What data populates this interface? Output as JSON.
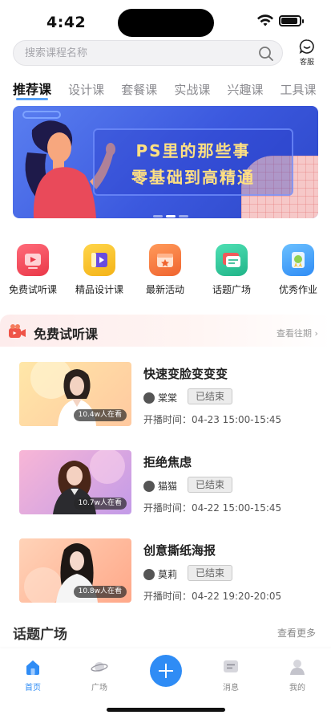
{
  "status_bar": {
    "time": "4:42"
  },
  "search": {
    "placeholder": "搜索课程名称"
  },
  "service": {
    "label": "客服"
  },
  "tabs": [
    {
      "label": "推荐课",
      "active": true
    },
    {
      "label": "设计课"
    },
    {
      "label": "套餐课"
    },
    {
      "label": "实战课"
    },
    {
      "label": "兴趣课"
    },
    {
      "label": "工具课"
    }
  ],
  "banner": {
    "line1": "PS里的那些事",
    "line2": "零基础到高精通"
  },
  "quick_nav": [
    {
      "label": "免费试听课",
      "icon": "play-screen-icon",
      "color": "#f04a5a"
    },
    {
      "label": "精品设计课",
      "icon": "video-book-icon",
      "color": "#f6c12b"
    },
    {
      "label": "最新活动",
      "icon": "star-calendar-icon",
      "color": "#f2733a"
    },
    {
      "label": "话题广场",
      "icon": "chat-cards-icon",
      "color": "#2ec59b"
    },
    {
      "label": "优秀作业",
      "icon": "medal-icon",
      "color": "#3e9df2"
    }
  ],
  "free_section": {
    "title": "免费试听课",
    "more": "查看往期 ›"
  },
  "courses": [
    {
      "title": "快速变脸变变变",
      "teacher": "棠棠",
      "status": "已结束",
      "time": "开播时间：04-23 15:00-15:45",
      "viewers": "10.4w人在看"
    },
    {
      "title": "拒绝焦虑",
      "teacher": "猫猫",
      "status": "已结束",
      "time": "开播时间：04-22 15:00-15:45",
      "viewers": "10.7w人在看"
    },
    {
      "title": "创意撕纸海报",
      "teacher": "莫莉",
      "status": "已结束",
      "time": "开播时间：04-22 19:20-20:05",
      "viewers": "10.8w人在看"
    }
  ],
  "topic_section": {
    "title": "话题广场",
    "more": "查看更多"
  },
  "bottom_nav": [
    {
      "label": "首页",
      "icon": "home-icon",
      "active": true
    },
    {
      "label": "广场",
      "icon": "planet-icon"
    },
    {
      "label": "",
      "icon": "plus-icon"
    },
    {
      "label": "消息",
      "icon": "message-icon"
    },
    {
      "label": "我的",
      "icon": "profile-icon"
    }
  ],
  "colors": {
    "accent": "#2f8cf5",
    "banner": "#3b58de"
  }
}
